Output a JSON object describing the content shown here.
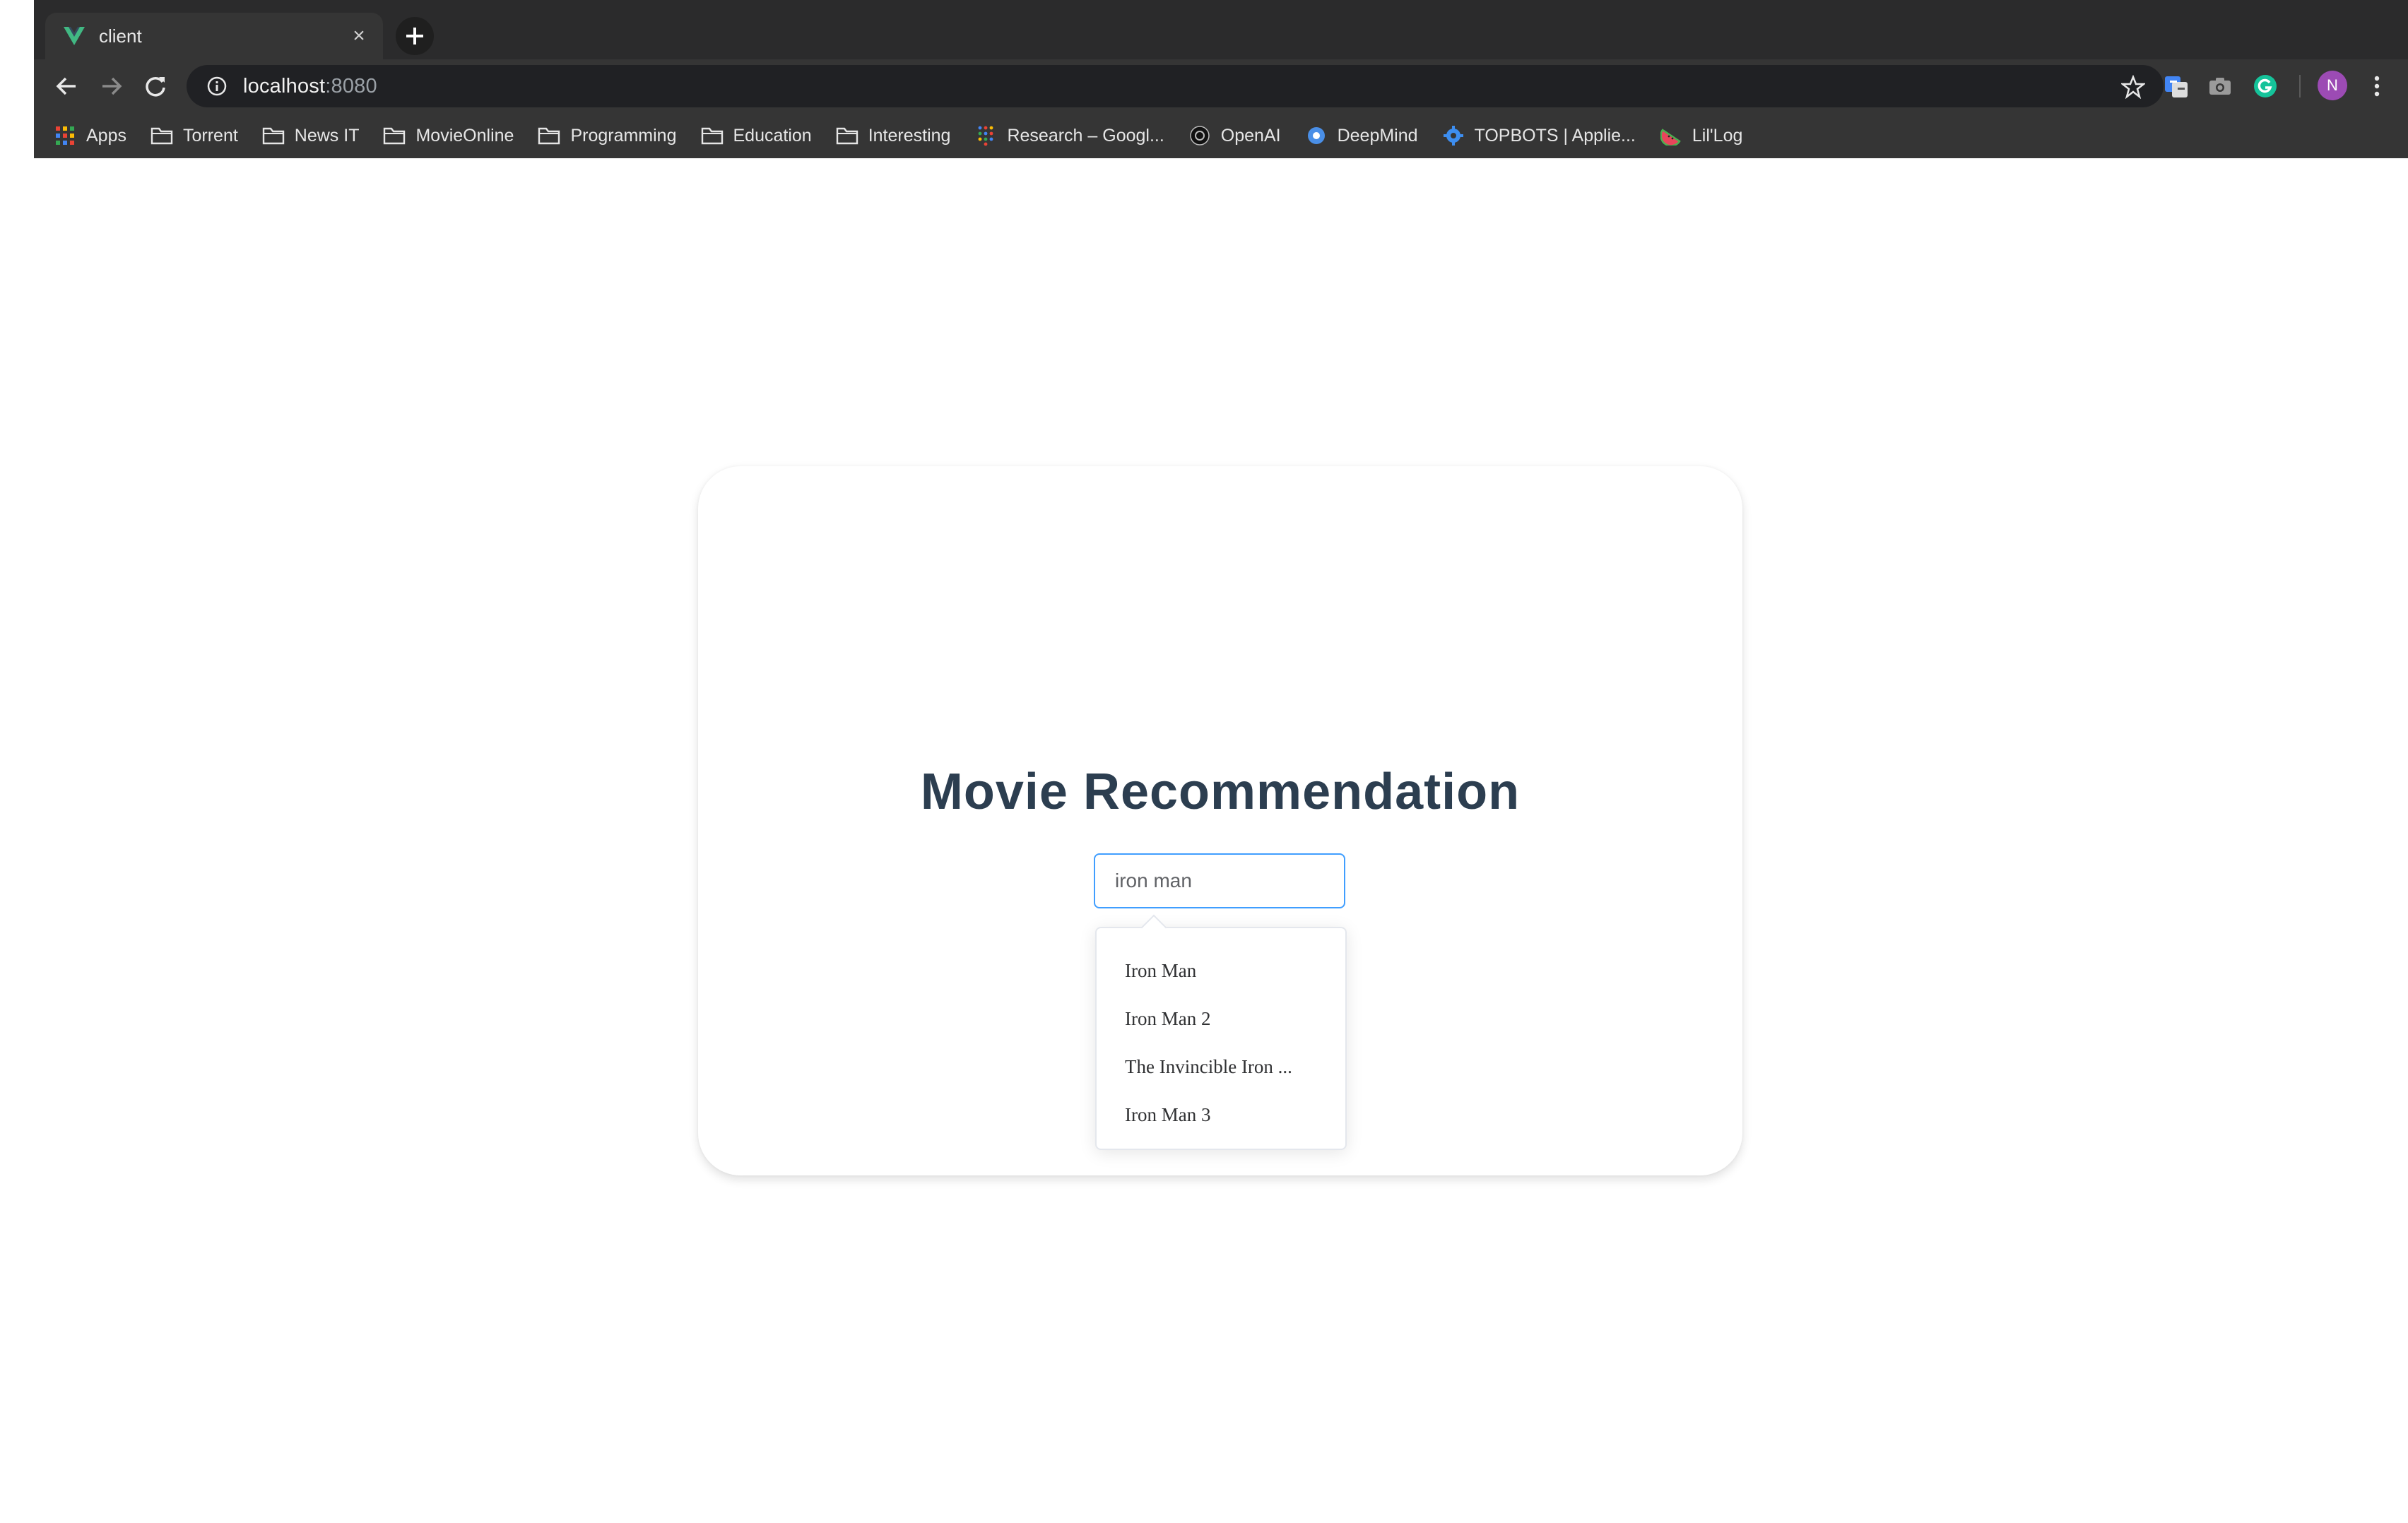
{
  "browser": {
    "tab": {
      "title": "client",
      "favicon": "vue-logo-icon",
      "close_glyph": "×"
    },
    "new_tab_glyph": "+",
    "address": {
      "host": "localhost",
      "port": ":8080"
    },
    "profile_initial": "N",
    "bookmarks": [
      {
        "label": "Apps",
        "icon": "apps-grid-icon"
      },
      {
        "label": "Torrent",
        "icon": "folder-icon"
      },
      {
        "label": "News IT",
        "icon": "folder-icon"
      },
      {
        "label": "MovieOnline",
        "icon": "folder-icon"
      },
      {
        "label": "Programming",
        "icon": "folder-icon"
      },
      {
        "label": "Education",
        "icon": "folder-icon"
      },
      {
        "label": "Interesting",
        "icon": "folder-icon"
      },
      {
        "label": "Research – Googl...",
        "icon": "google-research-icon"
      },
      {
        "label": "OpenAI",
        "icon": "openai-icon"
      },
      {
        "label": "DeepMind",
        "icon": "deepmind-icon"
      },
      {
        "label": "TOPBOTS | Applie...",
        "icon": "gear-icon"
      },
      {
        "label": "Lil'Log",
        "icon": "watermelon-icon"
      }
    ]
  },
  "main": {
    "title": "Movie Recommendation",
    "search": {
      "value": "iron man"
    },
    "suggestions": [
      "Iron Man",
      "Iron Man 2",
      "The Invincible Iron ...",
      "Iron Man 3"
    ]
  },
  "colors": {
    "accent": "#409eff",
    "title": "#2c3e50",
    "chrome": "#353535"
  }
}
